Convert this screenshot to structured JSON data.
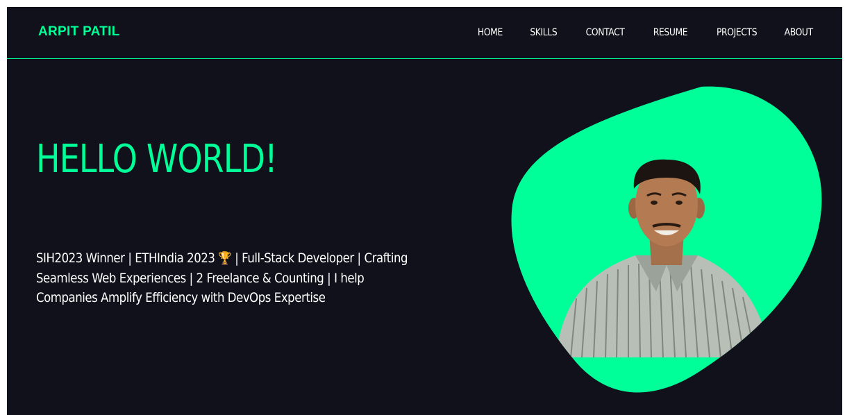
{
  "navbar": {
    "brand": "ARPIT PATIL",
    "links": [
      "HOME",
      "SKILLS",
      "CONTACT",
      "RESUME",
      "PROJECTS",
      "ABOUT"
    ]
  },
  "hero": {
    "title": "HELLO WORLD!",
    "desc_part1": "SIH2023 Winner | ETHIndia 2023",
    "trophy": "🏆",
    "desc_part2": " | Full-Stack Developer | Crafting Seamless Web Experiences | 2 Freelance & Counting | I help Companies Amplify Efficiency with DevOps Expertise"
  },
  "colors": {
    "accent": "#00ff99",
    "background": "#11111b",
    "text": "#ffffff"
  },
  "icons": {
    "trophy": "trophy-icon"
  }
}
